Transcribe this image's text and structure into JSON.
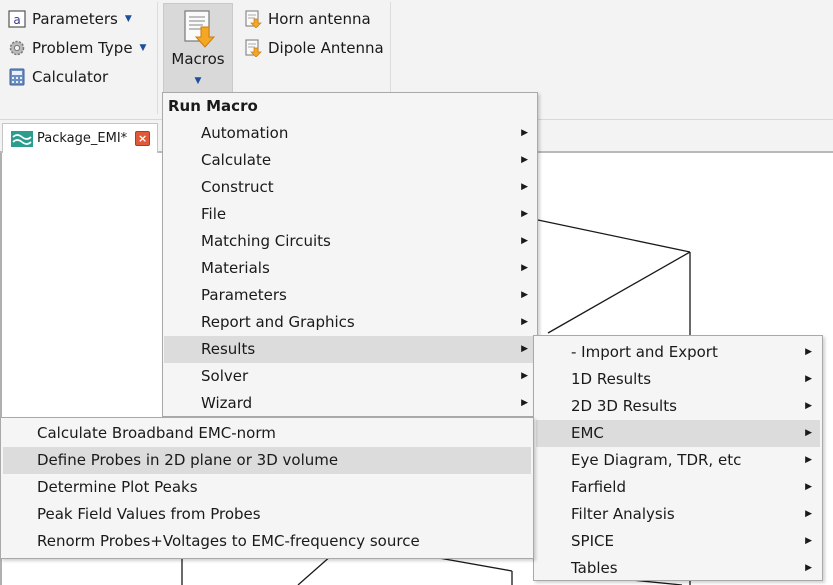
{
  "ribbon": {
    "parameters_label": "Parameters",
    "problem_type_label": "Problem Type",
    "calculator_label": "Calculator",
    "macros_label": "Macros",
    "horn_antenna_label": "Horn antenna",
    "dipole_antenna_label": "Dipole Antenna"
  },
  "tab": {
    "name": "Package_EMI*",
    "close_glyph": "×"
  },
  "run_macro_menu": {
    "title": "Run Macro",
    "items": [
      {
        "label": "Automation"
      },
      {
        "label": "Calculate"
      },
      {
        "label": "Construct"
      },
      {
        "label": "File"
      },
      {
        "label": "Matching Circuits"
      },
      {
        "label": "Materials"
      },
      {
        "label": "Parameters"
      },
      {
        "label": "Report and Graphics"
      },
      {
        "label": "Results"
      },
      {
        "label": "Solver"
      },
      {
        "label": "Wizard"
      }
    ],
    "highlighted": "Results"
  },
  "results_menu": {
    "items": [
      {
        "label": "- Import and Export"
      },
      {
        "label": "1D Results"
      },
      {
        "label": "2D 3D Results"
      },
      {
        "label": "EMC"
      },
      {
        "label": "Eye Diagram, TDR, etc"
      },
      {
        "label": "Farfield"
      },
      {
        "label": "Filter Analysis"
      },
      {
        "label": "SPICE"
      },
      {
        "label": "Tables"
      }
    ],
    "highlighted": "EMC"
  },
  "emc_menu": {
    "items": [
      {
        "label": "Calculate Broadband EMC-norm"
      },
      {
        "label": "Define Probes in 2D plane or 3D volume"
      },
      {
        "label": "Determine Plot Peaks"
      },
      {
        "label": "Peak Field Values from Probes"
      },
      {
        "label": "Renorm Probes+Voltages to EMC-frequency source"
      }
    ],
    "highlighted": "Define Probes in 2D plane or 3D volume"
  },
  "colors": {
    "ribbon_bg": "#f3f3f3",
    "highlight_bg": "#dcdcdc",
    "caret_blue": "#1f4e9c",
    "macro_orange": "#f5a623",
    "close_red": "#e05a3a"
  }
}
